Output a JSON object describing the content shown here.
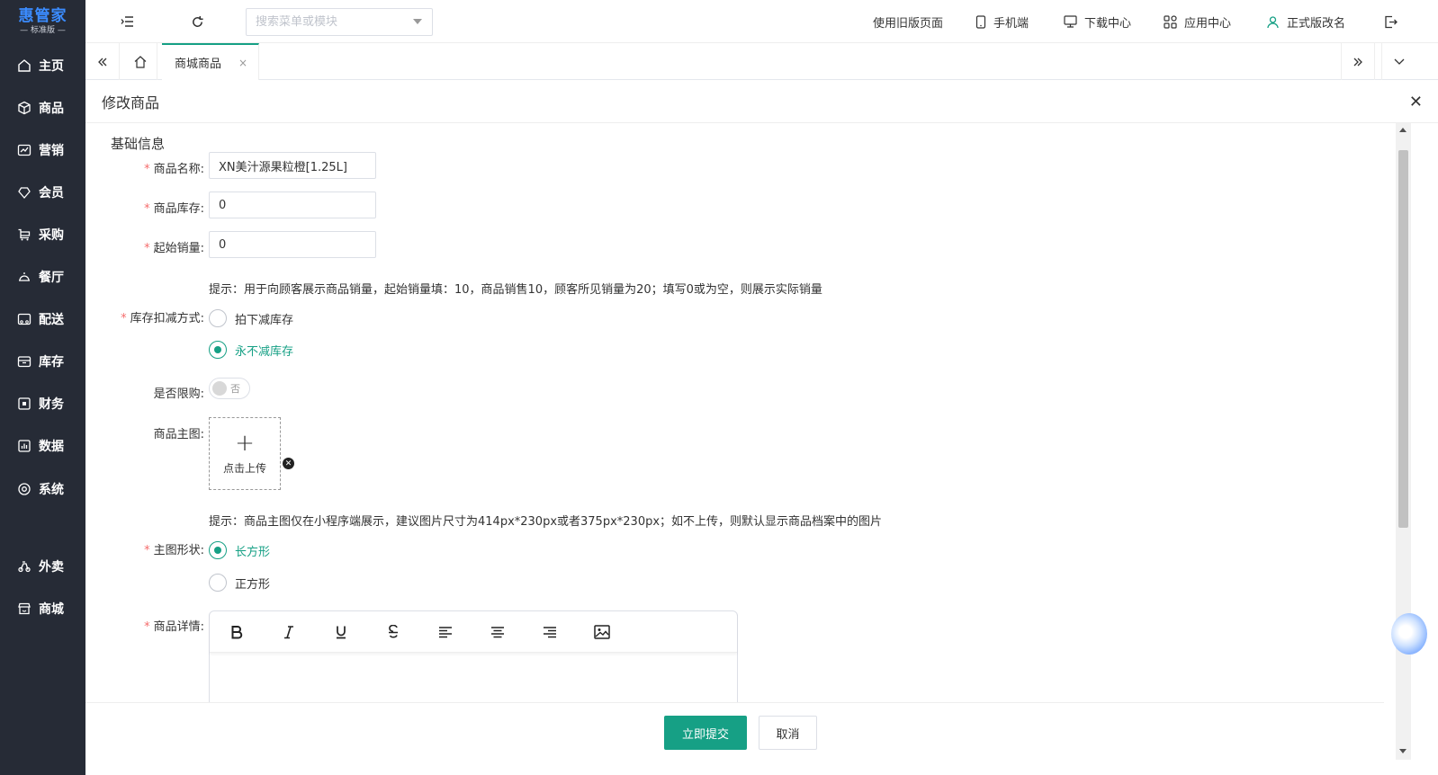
{
  "app": {
    "logo_main": "惠管家",
    "logo_sub": "— 标准版 —"
  },
  "sidebar": {
    "items": [
      {
        "label": "主页",
        "icon": "home-icon"
      },
      {
        "label": "商品",
        "icon": "box-icon"
      },
      {
        "label": "营销",
        "icon": "trend-icon"
      },
      {
        "label": "会员",
        "icon": "diamond-icon"
      },
      {
        "label": "采购",
        "icon": "cart-icon"
      },
      {
        "label": "餐厅",
        "icon": "cloche-icon"
      },
      {
        "label": "配送",
        "icon": "delivery-icon"
      },
      {
        "label": "库存",
        "icon": "inventory-icon"
      },
      {
        "label": "财务",
        "icon": "finance-icon"
      },
      {
        "label": "数据",
        "icon": "data-icon"
      },
      {
        "label": "系统",
        "icon": "system-icon"
      },
      {
        "label": "外卖",
        "icon": "takeout-icon"
      },
      {
        "label": "商城",
        "icon": "store-icon"
      }
    ]
  },
  "topbar": {
    "search_placeholder": "搜索菜单或模块",
    "old_version": "使用旧版页面",
    "mobile": "手机端",
    "download": "下载中心",
    "apps": "应用中心",
    "account": "正式版改名"
  },
  "tabs": {
    "active_label": "商城商品",
    "close_glyph": "×"
  },
  "panel": {
    "title": "修改商品",
    "close_glyph": "✕"
  },
  "form": {
    "section_title": "基础信息",
    "name_label": "商品名称:",
    "name_value": "XN美汁源果粒橙[1.25L]",
    "stock_label": "商品库存:",
    "stock_value": "0",
    "initial_sales_label": "起始销量:",
    "initial_sales_value": "0",
    "sales_hint": "提示：用于向顾客展示商品销量，起始销量填：10，商品销售10，顾客所见销量为20；填写0或为空，则展示实际销量",
    "deduct_label": "库存扣减方式:",
    "deduct_options": [
      "拍下减库存",
      "永不减库存"
    ],
    "deduct_selected": "永不减库存",
    "limit_label": "是否限购:",
    "limit_state": "否",
    "image_label": "商品主图:",
    "upload_text": "点击上传",
    "image_hint": "提示：商品主图仅在小程序端展示，建议图片尺寸为414px*230px或者375px*230px；如不上传，则默认显示商品档案中的图片",
    "shape_label": "主图形状:",
    "shape_options": [
      "长方形",
      "正方形"
    ],
    "shape_selected": "长方形",
    "detail_label": "商品详情:",
    "editor_tools": [
      "bold-icon",
      "italic-icon",
      "underline-icon",
      "strikethrough-icon",
      "align-left-icon",
      "align-center-icon",
      "align-right-icon",
      "image-icon"
    ]
  },
  "footer": {
    "submit": "立即提交",
    "cancel": "取消"
  },
  "colors": {
    "sidebar_bg": "#262b36",
    "accent": "#16a085",
    "required": "#f56c6c",
    "logo": "#3b8cff"
  }
}
